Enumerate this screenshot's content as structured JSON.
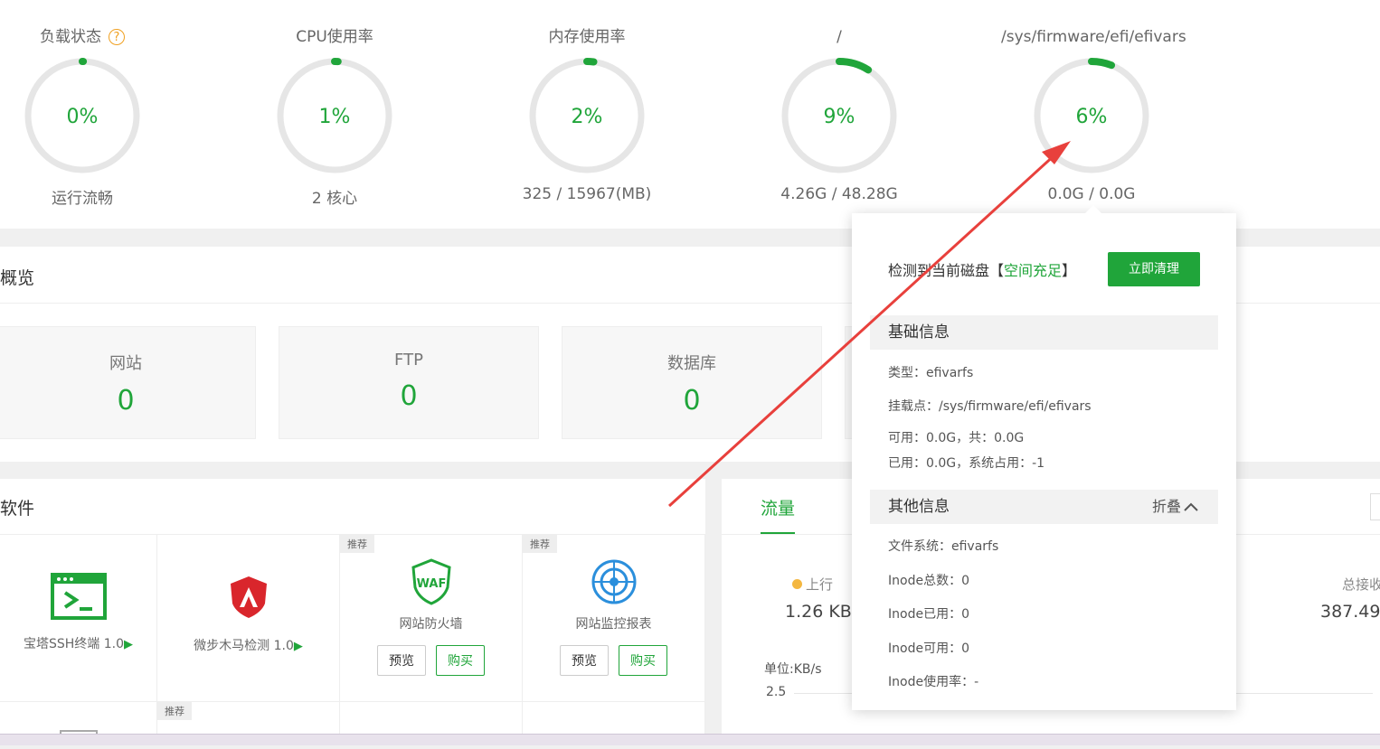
{
  "gauges": [
    {
      "title": "负载状态",
      "value": "0%",
      "sub": "运行流畅",
      "percent": 0
    },
    {
      "title": "CPU使用率",
      "value": "1%",
      "sub": "2 核心",
      "percent": 1
    },
    {
      "title": "内存使用率",
      "value": "2%",
      "sub": "325 / 15967(MB)",
      "percent": 2
    },
    {
      "title": "/",
      "value": "9%",
      "sub": "4.26G / 48.28G",
      "percent": 9
    },
    {
      "title": "/sys/firmware/efi/efivars",
      "value": "6%",
      "sub": "0.0G / 0.0G",
      "percent": 6
    }
  ],
  "help_glyph": "?",
  "overview": {
    "title": "概览",
    "cards": [
      {
        "label": "网站",
        "value": "0"
      },
      {
        "label": "FTP",
        "value": "0"
      },
      {
        "label": "数据库",
        "value": "0"
      }
    ]
  },
  "software": {
    "title": "软件",
    "items": [
      {
        "name": "宝塔SSH终端 1.0",
        "tag": "",
        "icon": "terminal-icon"
      },
      {
        "name": "微步木马检测 1.0",
        "tag": "",
        "icon": "shield-icon"
      },
      {
        "name": "网站防火墙",
        "tag": "推荐",
        "icon": "waf-icon",
        "preview": "预览",
        "buy": "购买"
      },
      {
        "name": "网站监控报表",
        "tag": "推荐",
        "icon": "radar-icon",
        "preview": "预览",
        "buy": "购买"
      }
    ],
    "row2_tag": "推荐"
  },
  "traffic": {
    "tab": "流量",
    "up_label": "上行",
    "up_value": "1.26 KB",
    "total_recv_label": "总接收",
    "total_recv_value": "387.49",
    "unit": "单位:KB/s",
    "y_tick": "2.5"
  },
  "disk_popup": {
    "head_prefix": "检测到当前磁盘【",
    "head_status": "空间充足",
    "head_suffix": "】",
    "clean_button": "立即清理",
    "basic_title": "基础信息",
    "type": "类型：efivarfs",
    "mount": "挂载点：/sys/firmware/efi/efivars",
    "avail": "可用：0.0G，共：0.0G",
    "used": "已用：0.0G，系统占用：-1",
    "other_title": "其他信息",
    "fold": "折叠",
    "fs": "文件系统：efivarfs",
    "inode_total": "Inode总数：0",
    "inode_used": "Inode已用：0",
    "inode_avail": "Inode可用：0",
    "inode_rate": "Inode使用率：-"
  },
  "colors": {
    "accent": "#20a53a",
    "warn": "#f0a020",
    "arrow": "#e8403c"
  }
}
